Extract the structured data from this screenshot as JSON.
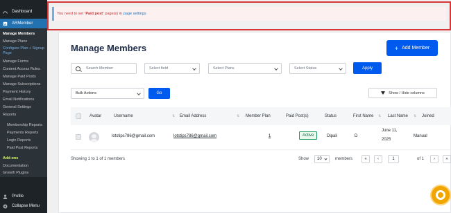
{
  "sidebar": {
    "dashboard": "Dashboard",
    "armember": "ARMember",
    "items": [
      "Manage Members",
      "Manage Plans",
      "Configure Plan + Signup Page",
      "Manage Forms",
      "Content Access Rules",
      "Manage Paid Posts",
      "Manage Subscriptions",
      "Payment History",
      "Email Notifications",
      "General Settings",
      "Reports"
    ],
    "reports": [
      "Membership Reports",
      "Payments Reports",
      "Login Reports",
      "Paid Post Reports"
    ],
    "addons": "Add-ons",
    "documentation": "Documentation",
    "growth": "Growth Plugins",
    "profile": "Profile",
    "collapse": "Collapse Menu"
  },
  "notice": {
    "prefix": "You need to set",
    "bold": "'Paid post'",
    "middle": "page(s) in",
    "link": "page settings"
  },
  "page": {
    "title": "Manage Members",
    "add_button": "Add Member"
  },
  "filters": {
    "search_placeholder": "Search Member",
    "field": "Select field",
    "plans": "Select Plans",
    "status": "Select Status",
    "apply": "Apply",
    "bulk": "Bulk Actions",
    "go": "Go",
    "columns": "Show / Hide columns"
  },
  "table": {
    "headers": {
      "avatar": "Avatar",
      "username": "Username",
      "email": "Email Address",
      "plan": "Member Plan",
      "paid": "Paid Post(s)",
      "status": "Status",
      "first": "First Name",
      "last": "Last Name",
      "joined": "Joined"
    },
    "rows": [
      {
        "username": "lotstips786@gmail.com",
        "email": "lotstips786@gmail.com",
        "plan": "1",
        "paid": "Active",
        "status": "Dipali",
        "first": "D",
        "last_line1": "June 11,",
        "last_line2": "2025",
        "joined": "Manual"
      }
    ]
  },
  "footer": {
    "showing": "Showing 1 to 1 of 1 members",
    "show": "Show",
    "per_page": "10",
    "members": "members",
    "page": "1",
    "of": "of 1"
  },
  "colors": {
    "primary": "#005aee",
    "sidebar": "#1d2327",
    "notice_border": "#d63638",
    "active_badge": "#1d9b5e"
  }
}
